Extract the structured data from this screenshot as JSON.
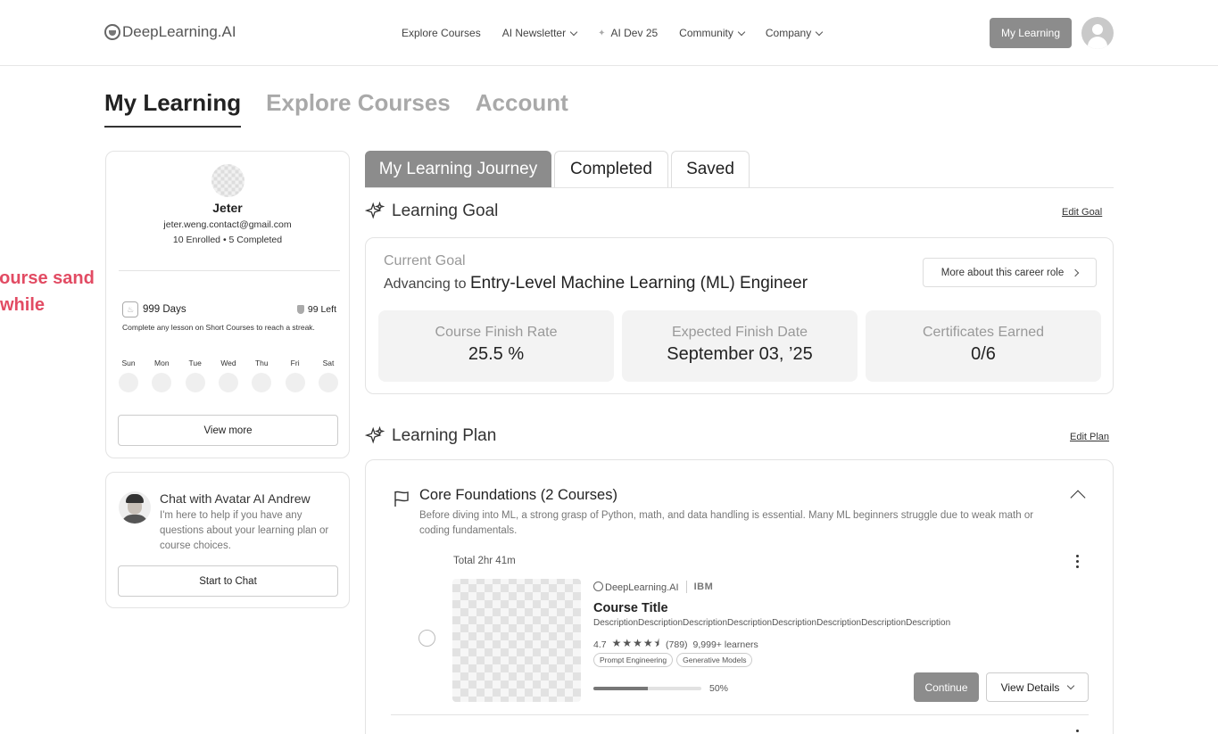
{
  "topbar": {
    "logo": "DeepLearning.AI",
    "nav": [
      {
        "label": "Explore Courses",
        "dropdown": false,
        "icon": ""
      },
      {
        "label": "AI Newsletter",
        "dropdown": true,
        "icon": ""
      },
      {
        "label": "AI Dev 25",
        "dropdown": false,
        "icon": "sparkle-icon"
      },
      {
        "label": "Community",
        "dropdown": true,
        "icon": ""
      },
      {
        "label": "Company",
        "dropdown": true,
        "icon": ""
      }
    ],
    "my_learning_button": "My Learning"
  },
  "page_tabs": [
    "My Learning",
    "Explore Courses",
    "Account"
  ],
  "profile": {
    "name": "Jeter",
    "email": "jeter.weng.contact@gmail.com",
    "stats": "10 Enrolled • 5 Completed",
    "streak_days": "999 Days",
    "streak_left": "99 Left",
    "streak_note": "Complete any lesson on Short Courses to reach a streak.",
    "weekdays": [
      "Sun",
      "Mon",
      "Tue",
      "Wed",
      "Thu",
      "Fri",
      "Sat"
    ],
    "view_more": "View more"
  },
  "chat": {
    "title": "Chat with Avatar AI Andrew",
    "description": "I'm here to help if you have any questions about your learning plan or course choices.",
    "button": "Start to Chat"
  },
  "overlay_text": {
    "line1": "course sand",
    "line2": "while"
  },
  "journey_tabs": [
    "My Learning Journey",
    "Completed",
    "Saved"
  ],
  "learning_goal": {
    "heading": "Learning Goal",
    "edit": "Edit Goal",
    "current_label": "Current Goal",
    "advancing_prefix": "Advancing to",
    "role": "Entry-Level Machine Learning  (ML) Engineer",
    "career_button": "More about this career role",
    "stats": [
      {
        "label": "Course Finish Rate",
        "value": "25.5 %"
      },
      {
        "label": "Expected Finish Date",
        "value": "September 03, ’25"
      },
      {
        "label": "Certificates Earned",
        "value": "0/6"
      }
    ]
  },
  "learning_plan": {
    "heading": "Learning Plan",
    "edit": "Edit Plan",
    "group_title": "Core Foundations (2 Courses)",
    "group_desc": "Before diving into ML, a strong grasp of Python, math, and data handling is essential. Many ML beginners struggle due to weak math or coding fundamentals.",
    "total": "Total 2hr 41m",
    "course": {
      "provider1": "DeepLearning.AI",
      "provider2": "IBM",
      "title": "Course Title",
      "description": "DescriptionDescriptionDescriptionDescriptionDescriptionDescriptionDescriptionDescription",
      "rating": "4.7",
      "stars": "★★★★",
      "half_star": "⯨",
      "reviews": "(789)",
      "learners": "9,999+ learners",
      "tags": [
        "Prompt Engineering",
        "Generative Models"
      ],
      "progress": 0.5,
      "progress_label": "50%",
      "continue": "Continue",
      "view_details": "View Details"
    }
  }
}
